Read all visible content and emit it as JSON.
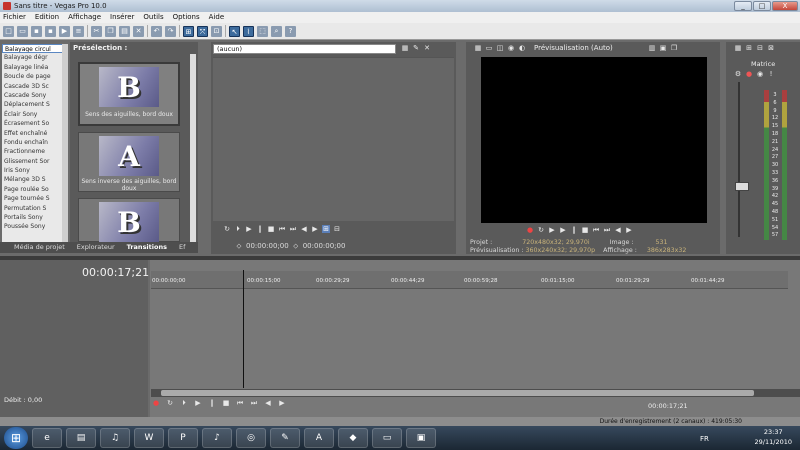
{
  "window": {
    "title": "Sans titre - Vegas Pro 10.0",
    "controls": [
      "_",
      "□",
      "X"
    ]
  },
  "menu": [
    "Fichier",
    "Edition",
    "Affichage",
    "Insérer",
    "Outils",
    "Options",
    "Aide"
  ],
  "toolbar_icons": [
    "new-icon",
    "open-icon",
    "save-icon",
    "save-as-icon",
    "render-icon",
    "properties-icon",
    "cut-icon",
    "copy-icon",
    "paste-icon",
    "delete-icon",
    "undo-icon",
    "redo-icon",
    "snap-icon",
    "auto-ripple-icon",
    "lock-envelopes-icon",
    "ignore-grouping-icon",
    "normal-edit-icon",
    "envelope-edit-icon",
    "selection-edit-icon",
    "zoom-edit-icon",
    "help-icon"
  ],
  "transitions_list": [
    "Balayage circul",
    "Balayage dégr",
    "Balayage linéa",
    "Boucle de page",
    "Cascade 3D Sc",
    "Cascade Sony",
    "Déplacement S",
    "Éclair Sony",
    "Écrasement So",
    "Effet enchaîné",
    "Fondu enchaîn",
    "Fractionneme",
    "Glissement Sor",
    "Iris Sony",
    "Mélange 3D S",
    "Page roulée So",
    "Page tournée S",
    "Permutation S",
    "Portails Sony",
    "Poussée Sony"
  ],
  "preselection": {
    "header": "Présélection :",
    "items": [
      {
        "label": "Sens des aiguilles, bord doux",
        "letter": "B"
      },
      {
        "label": "Sens inverse des aiguilles, bord doux",
        "letter": "A"
      },
      {
        "label": "",
        "letter": "B"
      }
    ]
  },
  "tabs": [
    "Média de projet",
    "Explorateur",
    "Transitions",
    "Ef"
  ],
  "trimmer": {
    "selector": "(aucun)",
    "tc_start": "00:00:00;00",
    "tc_end": "00:00:00;00"
  },
  "preview": {
    "label": "Prévisualisation (Auto)",
    "projet_k": "Projet :",
    "projet_v": "720x480x32; 29,970i",
    "prev_k": "Prévisualisation :",
    "prev_v": "360x240x32; 29,970p",
    "image_k": "Image :",
    "image_v": "531",
    "aff_k": "Affichage :",
    "aff_v": "386x283x32"
  },
  "master": {
    "label": "Matrice",
    "scale": [
      "-Inf.",
      "3",
      "6",
      "9",
      "12",
      "15",
      "18",
      "21",
      "24",
      "27",
      "30",
      "33",
      "36",
      "39",
      "42",
      "45",
      "48",
      "51",
      "54",
      "57"
    ]
  },
  "timeline": {
    "timecode": "00:00:17;21",
    "ruler": [
      "00:00:00;00",
      "00:00:15;00",
      "00:00:29;29",
      "00:00:44;29",
      "00:00:59;28",
      "00:01:15;00",
      "00:01:29;29",
      "00:01:44;29",
      "00:01:59;28"
    ],
    "transport_tc": "00:00:17;21",
    "rate_label": "Débit : 0,00"
  },
  "status_text": "Durée d'enregistrement (2 canaux) : 419:05:30",
  "taskbar": {
    "apps": [
      "ie-icon",
      "explorer-icon",
      "media-icon",
      "word-icon",
      "powerpoint-icon",
      "itunes-icon",
      "chrome-icon",
      "paint-icon",
      "acrobat-icon",
      "unknown-icon",
      "folder-icon",
      "vegas-icon"
    ],
    "lang": "FR",
    "time": "23:37",
    "date": "29/11/2010"
  }
}
